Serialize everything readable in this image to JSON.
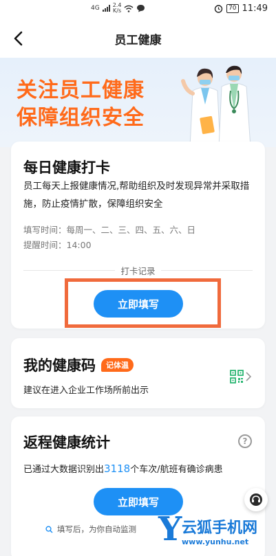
{
  "status_bar": {
    "network": "4G",
    "speed_value": "2.4",
    "speed_unit": "K/s",
    "battery": "70",
    "time": "11:49"
  },
  "nav": {
    "title": "员工健康"
  },
  "banner": {
    "line1": "关注员工健康",
    "line2": "保障组织安全"
  },
  "checkin_card": {
    "title": "每日健康打卡",
    "description": "员工每天上报健康情况,帮助组织及时发现异常并采取措施，防止疫情扩散，保障组织安全",
    "fill_time": "填写时间：每周一、二、三、四、五、六、日",
    "remind_time": "提醒时间：14:00",
    "record_link": "打卡记录",
    "button": "立即填写"
  },
  "health_code_card": {
    "title": "我的健康码",
    "badge": "记体温",
    "description": "建议在进入企业工作场所前出示"
  },
  "return_stats_card": {
    "title": "返程健康统计",
    "desc_prefix": "已通过大数据识别出",
    "count": "3118",
    "desc_suffix": "个车次/航班有确诊病患",
    "button": "立即填写",
    "hint": "填写后，为你自动监测"
  },
  "watermark": {
    "letter": "Y",
    "text": "云狐手机网",
    "url": "www.yunhu.net"
  },
  "colors": {
    "accent_blue": "#1e90f5",
    "accent_orange": "#ff6a1a",
    "highlight_border": "#f06a3c"
  }
}
